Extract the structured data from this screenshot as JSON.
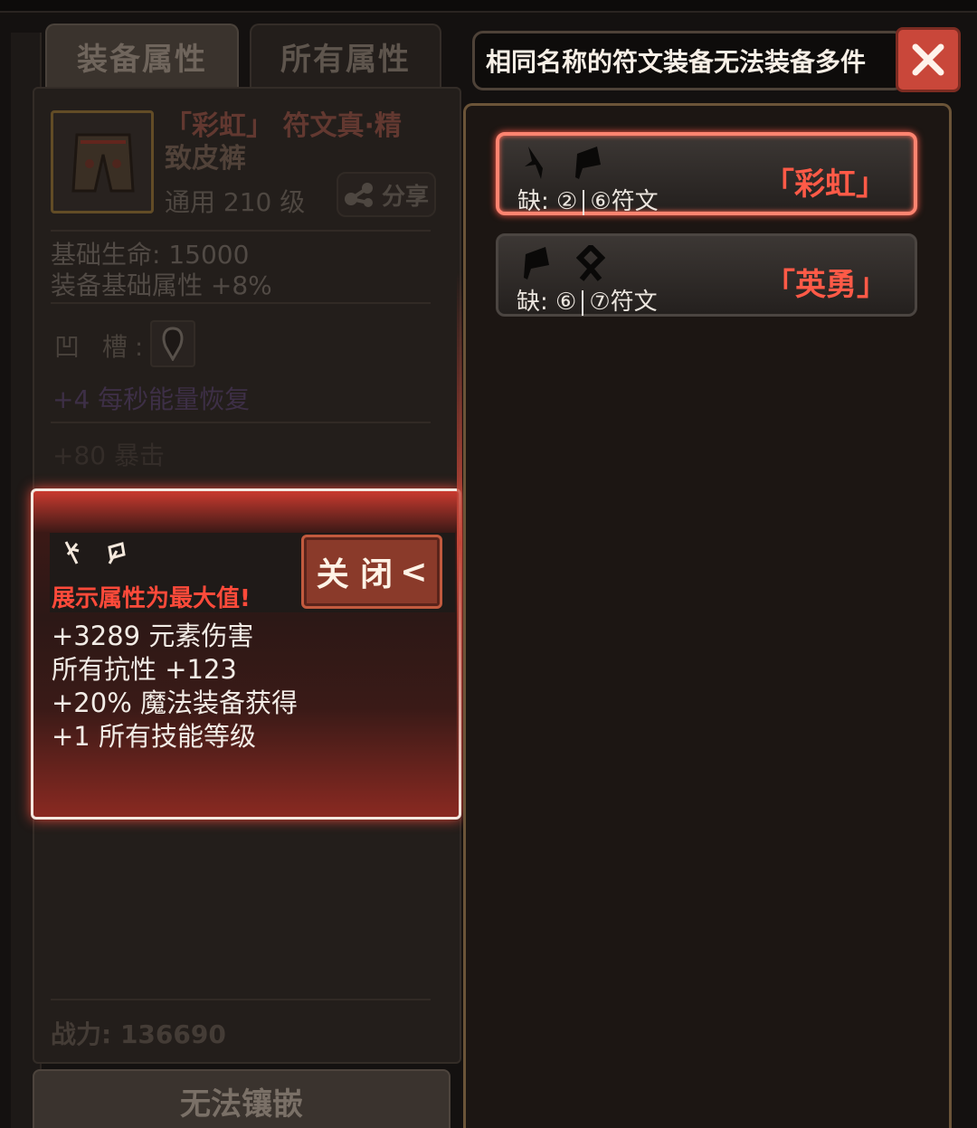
{
  "tabs": {
    "equip_attributes": "装备属性",
    "all_attributes": "所有属性"
  },
  "item": {
    "name_part1": "「彩虹」 符文真·精",
    "name_part2": "致皮裤",
    "level": "通用 210 级",
    "share_label": "分享"
  },
  "stats": {
    "base_hp": "基础生命:  15000",
    "base_attr": "装备基础属性 +8%",
    "socket_label": "凹 槽:",
    "energy_regen": "+4 每秒能量恢复",
    "crit": "+80 暴击"
  },
  "power": "战力: 136690",
  "inlay_button": "无法镶嵌",
  "popup": {
    "warning": "展示属性为最大值!",
    "close_label": "关 闭",
    "close_arrow": "<",
    "stats": [
      "+3289 元素伤害",
      "所有抗性 +123",
      "+20% 魔法装备获得",
      "+1 所有技能等级"
    ]
  },
  "notice": "相同名称的符文装备无法装备多件",
  "rune_words": [
    {
      "name": "「彩虹」",
      "missing_prefix": "缺:",
      "missing_a": "②",
      "missing_b": "⑥符文",
      "selected": true
    },
    {
      "name": "「英勇」",
      "missing_prefix": "缺:",
      "missing_a": "⑥",
      "missing_b": "⑦符文",
      "selected": false
    }
  ],
  "colors": {
    "accent_red": "#ff5a47",
    "glow": "#ff8470",
    "frame_gold": "#6b5438"
  }
}
